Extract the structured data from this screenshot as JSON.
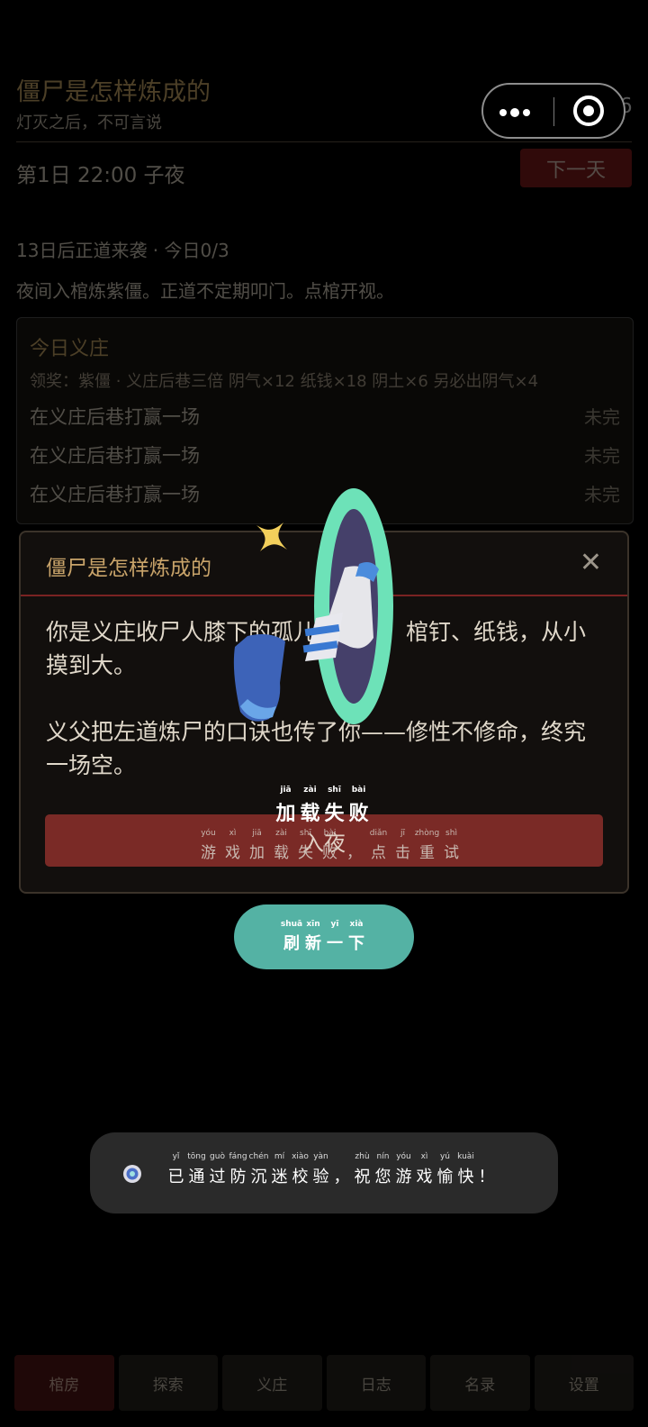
{
  "header": {
    "title": "僵尸是怎样炼成的",
    "subtitle": "灯灭之后，不可言说",
    "day_text": "第1日  22:00  子夜",
    "next_day_label": "下一天",
    "peek_text": "阴气 16"
  },
  "status": {
    "warning": "13日后正道来袭 · 今日0/3",
    "description": "夜间入棺炼紫僵。正道不定期叩门。点棺开视。"
  },
  "daily": {
    "title": "今日义庄",
    "reward": "领奖：紫僵 · 义庄后巷三倍  阴气×12  纸钱×18  阴土×6  另必出阴气×4",
    "tasks": [
      {
        "label": "在义庄后巷打赢一场",
        "status": "未完"
      },
      {
        "label": "在义庄后巷打赢一场",
        "status": "未完"
      },
      {
        "label": "在义庄后巷打赢一场",
        "status": "未完"
      }
    ]
  },
  "modal": {
    "title": "僵尸是怎样炼成的",
    "close_icon": "close-icon",
    "paragraph1": "你是义庄收尸人膝下的孤儿，桐油、棺钉、纸钱，从小摸到大。",
    "paragraph2": "义父把左道炼尸的口诀也传了你——修性不修命，终究一场空。",
    "enter_label": "入夜"
  },
  "loading_error": {
    "title": [
      {
        "py": "jiā",
        "hz": "加"
      },
      {
        "py": "zài",
        "hz": "载"
      },
      {
        "py": "shī",
        "hz": "失"
      },
      {
        "py": "bài",
        "hz": "败"
      }
    ],
    "subtitle": [
      {
        "py": "yóu",
        "hz": "游"
      },
      {
        "py": "xì",
        "hz": "戏"
      },
      {
        "py": "jiā",
        "hz": "加"
      },
      {
        "py": "zài",
        "hz": "载"
      },
      {
        "py": "shī",
        "hz": "失"
      },
      {
        "py": "bài",
        "hz": "败"
      },
      {
        "py": "",
        "hz": "，"
      },
      {
        "py": "diǎn",
        "hz": "点"
      },
      {
        "py": "jī",
        "hz": "击"
      },
      {
        "py": "zhòng",
        "hz": "重"
      },
      {
        "py": "shì",
        "hz": "试"
      }
    ],
    "refresh": [
      {
        "py": "shuā",
        "hz": "刷"
      },
      {
        "py": "xīn",
        "hz": "新"
      },
      {
        "py": "yī",
        "hz": "一"
      },
      {
        "py": "xià",
        "hz": "下"
      }
    ]
  },
  "toast": {
    "chars": [
      {
        "py": "yǐ",
        "hz": "已"
      },
      {
        "py": "tōng",
        "hz": "通"
      },
      {
        "py": "guò",
        "hz": "过"
      },
      {
        "py": "fáng",
        "hz": "防"
      },
      {
        "py": "chén",
        "hz": "沉"
      },
      {
        "py": "mí",
        "hz": "迷"
      },
      {
        "py": "xiào",
        "hz": "校"
      },
      {
        "py": "yàn",
        "hz": "验"
      },
      {
        "py": "",
        "hz": "，"
      },
      {
        "py": "zhù",
        "hz": "祝"
      },
      {
        "py": "nín",
        "hz": "您"
      },
      {
        "py": "yóu",
        "hz": "游"
      },
      {
        "py": "xì",
        "hz": "戏"
      },
      {
        "py": "yú",
        "hz": "愉"
      },
      {
        "py": "kuài",
        "hz": "快"
      },
      {
        "py": "",
        "hz": "！"
      }
    ]
  },
  "nav": [
    {
      "label": "棺房",
      "active": true
    },
    {
      "label": "探索",
      "active": false
    },
    {
      "label": "义庄",
      "active": false
    },
    {
      "label": "日志",
      "active": false
    },
    {
      "label": "名录",
      "active": false
    },
    {
      "label": "设置",
      "active": false
    }
  ],
  "colors": {
    "accent_gold": "#c9a46a",
    "danger_red": "#7a2a26",
    "refresh_teal": "#54b2a4",
    "portal_green": "#6de2b8"
  }
}
